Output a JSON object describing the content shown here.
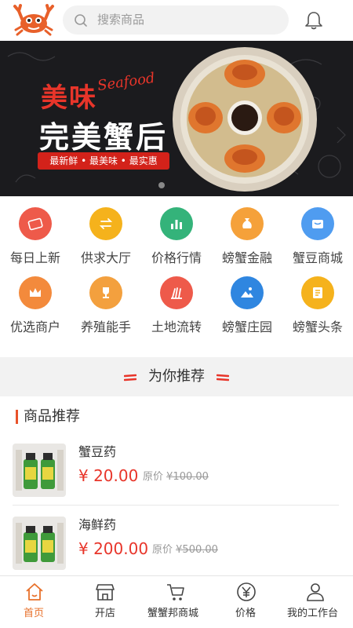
{
  "header": {
    "search_placeholder": "搜索商品"
  },
  "banner": {
    "title_line1": "美味",
    "title_script": "Seafood",
    "title_line2": "完美蟹后",
    "slogan": "最新鲜 • 最美味 • 最实惠"
  },
  "grid": [
    {
      "label": "每日上新",
      "color": "#ee5a4a",
      "icon": "ticket-icon"
    },
    {
      "label": "供求大厅",
      "color": "#f5b21c",
      "icon": "exchange-icon"
    },
    {
      "label": "价格行情",
      "color": "#34b37a",
      "icon": "bar-chart-icon"
    },
    {
      "label": "螃蟹金融",
      "color": "#f5a13a",
      "icon": "money-bag-icon"
    },
    {
      "label": "蟹豆商城",
      "color": "#4f9cf0",
      "icon": "shop-box-icon"
    },
    {
      "label": "优选商户",
      "color": "#f38a3c",
      "icon": "crown-icon"
    },
    {
      "label": "养殖能手",
      "color": "#f3a03e",
      "icon": "trophy-icon"
    },
    {
      "label": "土地流转",
      "color": "#ee5a4a",
      "icon": "wheat-field-icon"
    },
    {
      "label": "螃蟹庄园",
      "color": "#2f86e0",
      "icon": "landscape-icon"
    },
    {
      "label": "螃蟹头条",
      "color": "#f5b21c",
      "icon": "news-icon"
    }
  ],
  "section": {
    "title": "为你推荐",
    "subtitle": "商品推荐"
  },
  "products": [
    {
      "name": "蟹豆药",
      "price": "¥ 20.00",
      "orig_label": "原价",
      "orig_price": "¥100.00"
    },
    {
      "name": "海鲜药",
      "price": "¥ 200.00",
      "orig_label": "原价",
      "orig_price": "¥500.00"
    }
  ],
  "tabs": [
    {
      "label": "首页",
      "icon": "home-icon",
      "active": true
    },
    {
      "label": "开店",
      "icon": "store-icon",
      "active": false
    },
    {
      "label": "蟹蟹邦商城",
      "icon": "cart-icon",
      "active": false
    },
    {
      "label": "价格",
      "icon": "yen-icon",
      "active": false
    },
    {
      "label": "我的工作台",
      "icon": "user-icon",
      "active": false
    }
  ],
  "colors": {
    "accent": "#e8702a",
    "price_red": "#e8352a",
    "section_bg": "#f2f2f2"
  }
}
